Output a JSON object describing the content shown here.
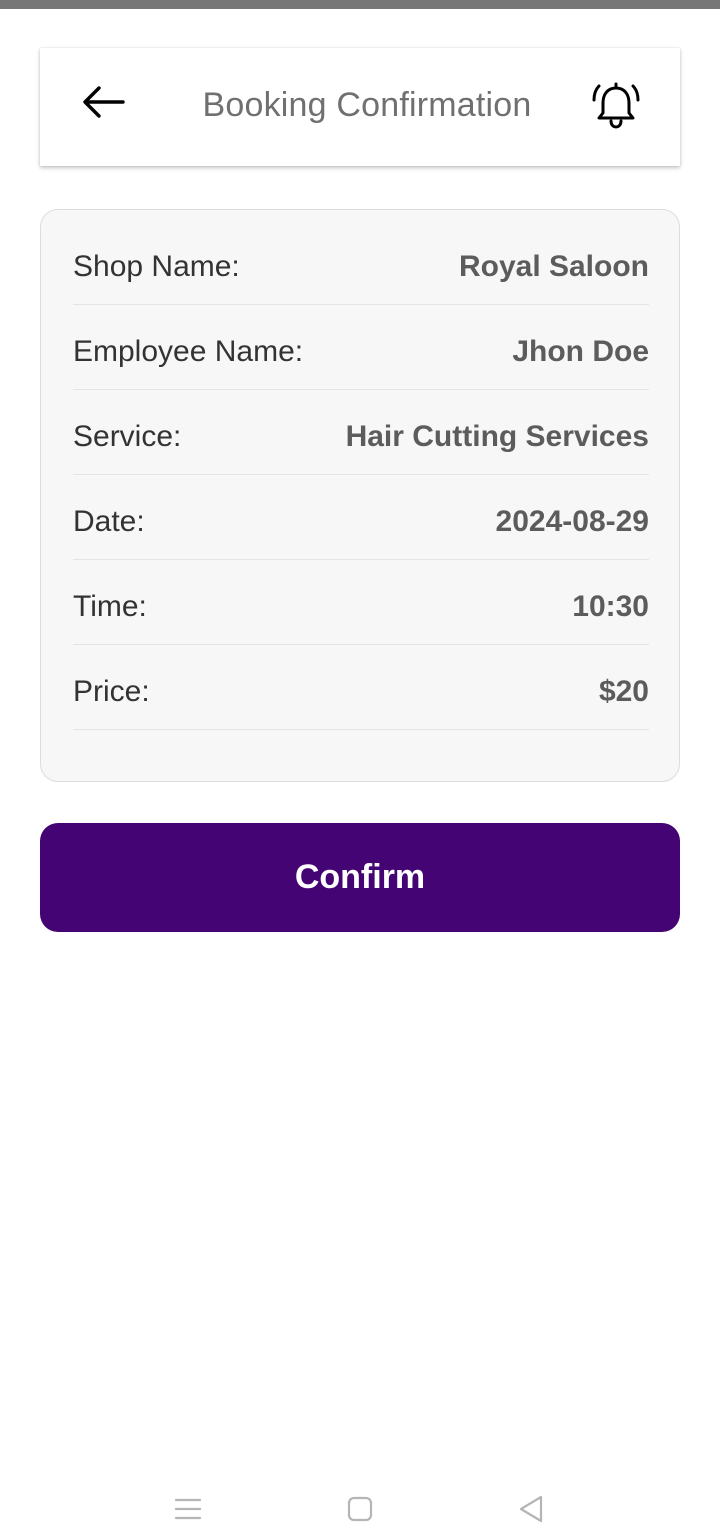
{
  "header": {
    "title": "Booking Confirmation",
    "back_icon": "arrow-left-icon",
    "notification_icon": "bell-icon"
  },
  "booking": {
    "rows": [
      {
        "label": "Shop Name:",
        "value": "Royal Saloon"
      },
      {
        "label": "Employee Name:",
        "value": "Jhon Doe "
      },
      {
        "label": "Service:",
        "value": "Hair Cutting Services"
      },
      {
        "label": "Date:",
        "value": "2024-08-29"
      },
      {
        "label": "Time:",
        "value": "10:30"
      },
      {
        "label": "Price:",
        "value": "$20"
      }
    ]
  },
  "actions": {
    "confirm_label": "Confirm"
  },
  "system_nav": {
    "icons": [
      "menu-icon",
      "home-icon",
      "back-triangle-icon"
    ]
  },
  "colors": {
    "accent": "#450473",
    "card_background": "#f7f7f7",
    "label_text": "#333333",
    "value_text": "#5c5c5c",
    "title_text": "#707070"
  }
}
